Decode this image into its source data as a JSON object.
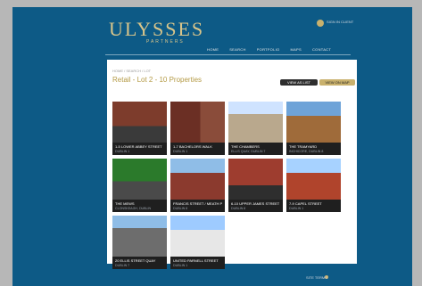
{
  "header": {
    "logo": "ULYSSES",
    "logo_sub": "PARTNERS",
    "top_text": "SIGN IN\nCLIENT"
  },
  "nav": {
    "items": [
      "HOME",
      "SEARCH",
      "PORTFOLIO",
      "MAPS",
      "CONTACT"
    ]
  },
  "content": {
    "breadcrumb": "HOME  /  SEARCH  /  LOT",
    "title": "Retail - Lot 2 - 10 Properties",
    "btn_list": "VIEW AS LIST",
    "btn_map": "VIEW ON MAP",
    "cards": [
      {
        "line1": "1-5 LOWER ABBEY STREET",
        "line2": "DUBLIN 1"
      },
      {
        "line1": "1-7 BACHELORS WALK",
        "line2": "DUBLIN 1"
      },
      {
        "line1": "THE CHAMBERS",
        "line2": "ELLIS QUAY, DUBLIN 7"
      },
      {
        "line1": "THE TRAMYARD",
        "line2": "INCHICORE, DUBLIN 8"
      },
      {
        "line1": "THE MEWS",
        "line2": "CLONSKEAGH, DUBLIN"
      },
      {
        "line1": "FRANCIS STREET / MEATH PLACE",
        "line2": "DUBLIN 8"
      },
      {
        "line1": "6-10 UPPER JAMES STREET",
        "line2": "DUBLIN 8"
      },
      {
        "line1": "7-9 CAPEL STREET",
        "line2": "DUBLIN 1"
      },
      {
        "line1": "20 ELLIS STREET QUAY",
        "line2": "DUBLIN 7"
      },
      {
        "line1": "UNITED PARNELL STREET",
        "line2": "DUBLIN 1"
      }
    ]
  },
  "footer": {
    "note": "SITE TERMS"
  }
}
